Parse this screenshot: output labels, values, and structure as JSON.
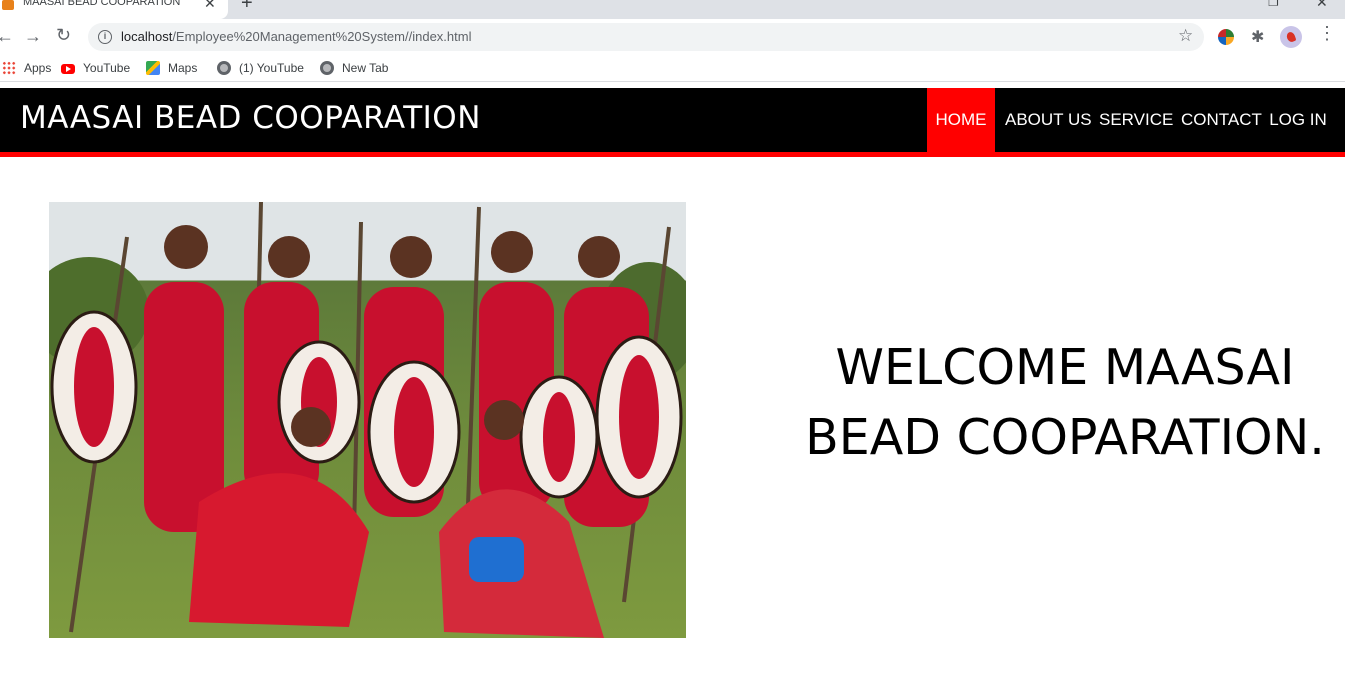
{
  "browser": {
    "tab_title": "MAASAI BEAD COOPARATION",
    "tab_close": "✕",
    "new_tab": "+",
    "url_host": "localhost",
    "url_path": "/Employee%20Management%20System//index.html",
    "bookmarks": [
      {
        "label": "Apps",
        "icon": "apps-grid-icon"
      },
      {
        "label": "YouTube",
        "icon": "youtube-icon"
      },
      {
        "label": "Maps",
        "icon": "maps-icon"
      },
      {
        "label": "(1) YouTube",
        "icon": "globe-icon"
      },
      {
        "label": "New Tab",
        "icon": "globe-icon"
      }
    ]
  },
  "site": {
    "title": "MAASAI BEAD COOPARATION",
    "nav": [
      {
        "label": "HOME",
        "active": true
      },
      {
        "label": "ABOUT US",
        "active": false
      },
      {
        "label": "SERVICE",
        "active": false
      },
      {
        "label": "CONTACT",
        "active": false
      },
      {
        "label": "LOG IN",
        "active": false
      }
    ],
    "welcome_line1": "WELCOME MAASAI",
    "welcome_line2": "BEAD COOPARATION."
  },
  "colors": {
    "header_bg": "#000000",
    "accent": "#ff0000",
    "text_light": "#ffffff"
  }
}
